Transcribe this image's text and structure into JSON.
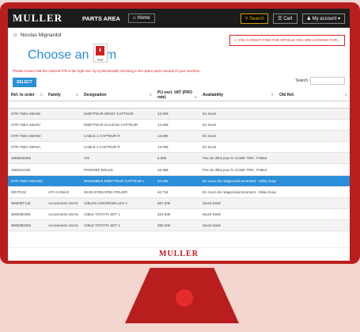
{
  "header": {
    "logo": "MULLER",
    "section": "PARTS AREA",
    "home_label": "Home",
    "search_label": "Search",
    "cart_label": "Cart",
    "account_label": "My account"
  },
  "user": {
    "name": "Nicolas Mignardot"
  },
  "warning": "YOU CANNOT FIND THE ARTICLE YOU ARE LOOKING FOR...",
  "page": {
    "title": "Choose an item",
    "pdf_label": "PDF",
    "notice": "Please ensure that the ordered P/N is the right one, by systematically checking in the spare parts manual of your machine.",
    "select_label": "SELECT",
    "search_label": "Search :",
    "search_placeholder": ""
  },
  "table": {
    "columns": [
      "Ref. to order",
      "Family",
      "Designation",
      "PU excl. VAT (PRO rate)",
      "Availability",
      "Old Ref."
    ],
    "rows": [
      [
        "GTR-758A-26HXE",
        "",
        "EMETTEUR DROIT CAPTEUR",
        "13.00€",
        "En stock",
        ""
      ],
      [
        "GTR-758A-26HXC",
        "",
        "EMETTEUR GAUCHE CAPTEUR",
        "13.00€",
        "En stock",
        ""
      ],
      [
        "GTR-758A-26HXD",
        "",
        "CABLE 1 CAPTEUR R",
        "13.00€",
        "En stock",
        ""
      ],
      [
        "GTR-758A-26HXA",
        "",
        "CABLE 2 CAPTEUR R",
        "13.00€",
        "En stock",
        ""
      ],
      [
        "1965846065",
        "",
        "VIS",
        "6.09€",
        "Pas de délai pour le CODE TRN : P3664",
        ""
      ],
      [
        "1860411190",
        "",
        "POIGNEE BOULE",
        "16.09€",
        "Pas de délai pour le CODE TRN : P3664",
        ""
      ],
      [
        "GTR-758A-26HXZZ",
        "",
        "ENSEMBLE EMETTEUR CAPTEUR L",
        "40.00€",
        "En cours de réapprovisionnement - Délai moyen de 6 semaines",
        ""
      ],
      [
        "MO P102",
        "ATH CANKI3",
        "MAIN D'OEUVRE ATELIER",
        "62.71€",
        "En cours de réapprovisionnement - Délai moyen de 6 semaines",
        ""
      ],
      [
        "W8028T142",
        "Accessoires ADAS",
        "CIBLES UNIVERSELLES 2",
        "667.00€",
        "Stock limité",
        ""
      ],
      [
        "W8028D081",
        "Accessoires ADAS",
        "CIBLE TOYOTA SET 1",
        "324.00€",
        "Stock limité",
        ""
      ],
      [
        "W8028D050",
        "Accessoires ADAS",
        "CIBLE TOYOTA SET 1",
        "360.00€",
        "Stock limité",
        ""
      ]
    ],
    "selected_row": 6
  },
  "footer": {
    "logo": "MULLER"
  },
  "colors": {
    "brand_red": "#b91e1e",
    "accent_blue": "#2a8ed8"
  }
}
